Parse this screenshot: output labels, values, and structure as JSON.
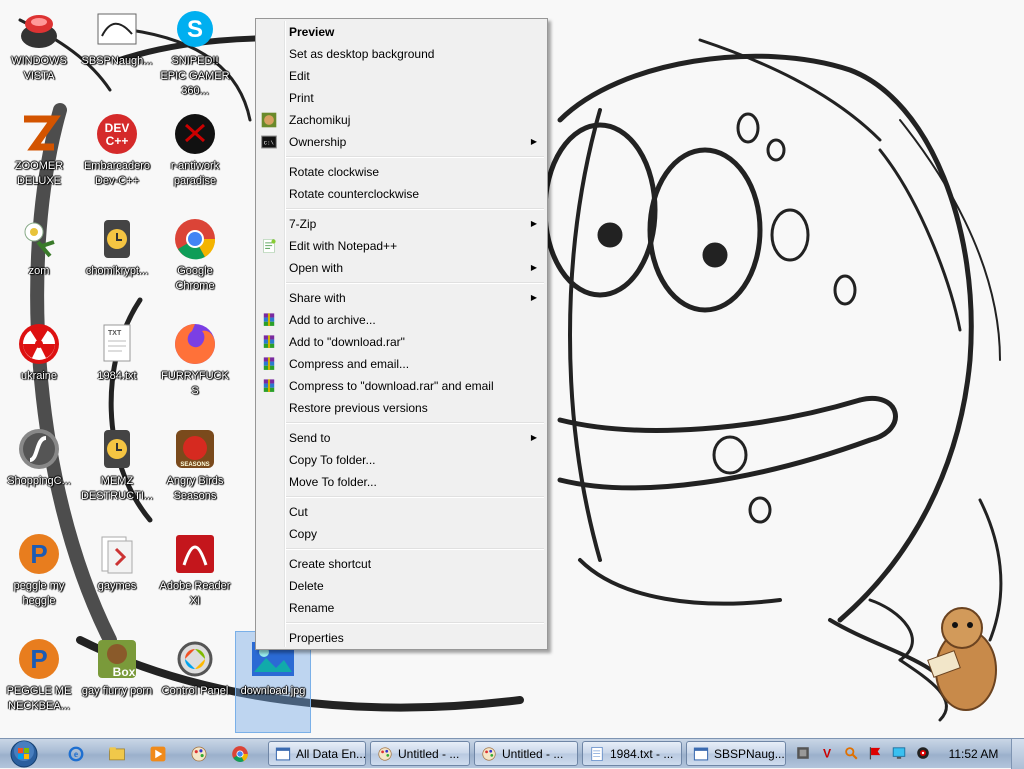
{
  "desktop": {
    "icons": [
      {
        "label": "WINDOWS VISTA",
        "icon": "vista-bowl-icon"
      },
      {
        "label": "SBSPNaugh...",
        "icon": "sketch-image-icon"
      },
      {
        "label": "SNIPED!! EPIC GAMER 360...",
        "icon": "skype-icon"
      },
      {
        "label": "ZOOMER DELUXE",
        "icon": "zoomer-icon"
      },
      {
        "label": "Embarcadero Dev-C++",
        "icon": "devcpp-icon"
      },
      {
        "label": "r-antiwork paradise",
        "icon": "antiwork-icon"
      },
      {
        "label": "zom",
        "icon": "plant-zombie-icon"
      },
      {
        "label": "chomikrypt...",
        "icon": "timer-app-icon"
      },
      {
        "label": "Google Chrome",
        "icon": "chrome-icon"
      },
      {
        "label": "ukraine",
        "icon": "radiation-icon"
      },
      {
        "label": "1984.txt",
        "icon": "text-file-icon"
      },
      {
        "label": "FURRYFUCKS",
        "icon": "firefox-icon"
      },
      {
        "label": "ShoppingC...",
        "icon": "flash-icon"
      },
      {
        "label": "MEMZ DESTRUCTI...",
        "icon": "timer-app-icon"
      },
      {
        "label": "Angry Birds Seasons",
        "icon": "angry-birds-icon"
      },
      {
        "label": "peggle my heggle",
        "icon": "peggle-icon"
      },
      {
        "label": "gaymes",
        "icon": "folder-icon"
      },
      {
        "label": "Adobe Reader XI",
        "icon": "adobe-reader-icon"
      },
      {
        "label": "PEGGLE ME NECKBEA...",
        "icon": "peggle-icon"
      },
      {
        "label": "gay fiurry porn",
        "icon": "box-beaver-icon"
      },
      {
        "label": "Control Panel",
        "icon": "control-panel-icon"
      },
      {
        "label": "download.jpg",
        "icon": "image-file-icon"
      }
    ]
  },
  "context_menu": {
    "items": [
      {
        "label": "Preview",
        "bold": true
      },
      {
        "label": "Set as desktop background"
      },
      {
        "label": "Edit"
      },
      {
        "label": "Print"
      },
      {
        "label": "Zachomikuj",
        "icon": "hamster-icon"
      },
      {
        "label": "Ownership",
        "icon": "cmd-icon",
        "submenu": true
      },
      {
        "sep": true
      },
      {
        "label": "Rotate clockwise"
      },
      {
        "label": "Rotate counterclockwise"
      },
      {
        "sep": true
      },
      {
        "label": "7-Zip",
        "submenu": true
      },
      {
        "label": "Edit with Notepad++",
        "icon": "notepad-plus-icon"
      },
      {
        "label": "Open with",
        "submenu": true
      },
      {
        "sep": true
      },
      {
        "label": "Share with",
        "submenu": true
      },
      {
        "label": "Add to archive...",
        "icon": "winrar-icon"
      },
      {
        "label": "Add to \"download.rar\"",
        "icon": "winrar-icon"
      },
      {
        "label": "Compress and email...",
        "icon": "winrar-icon"
      },
      {
        "label": "Compress to \"download.rar\" and email",
        "icon": "winrar-icon"
      },
      {
        "label": "Restore previous versions"
      },
      {
        "sep": true
      },
      {
        "label": "Send to",
        "submenu": true
      },
      {
        "label": "Copy To folder..."
      },
      {
        "label": "Move To folder..."
      },
      {
        "sep": true
      },
      {
        "label": "Cut"
      },
      {
        "label": "Copy"
      },
      {
        "sep": true
      },
      {
        "label": "Create shortcut"
      },
      {
        "label": "Delete"
      },
      {
        "label": "Rename"
      },
      {
        "sep": true
      },
      {
        "label": "Properties"
      }
    ]
  },
  "taskbar": {
    "quick_launch": [
      "ie-icon",
      "explorer-icon",
      "media-player-icon",
      "paint-icon",
      "chrome-icon"
    ],
    "buttons": [
      {
        "label": "All Data En...",
        "icon": "window-icon"
      },
      {
        "label": "Untitled - ...",
        "icon": "paint-icon"
      },
      {
        "label": "Untitled - ...",
        "icon": "paint-icon"
      },
      {
        "label": "1984.txt - ...",
        "icon": "notepad-icon"
      },
      {
        "label": "SBSPNaug...",
        "icon": "window-icon"
      }
    ],
    "tray_icons": [
      "tray-app-icon",
      "tray-v-icon",
      "tray-search-icon",
      "tray-flag-icon",
      "tray-monitor-icon",
      "tray-speaker-icon"
    ],
    "clock": "11:52 AM"
  }
}
